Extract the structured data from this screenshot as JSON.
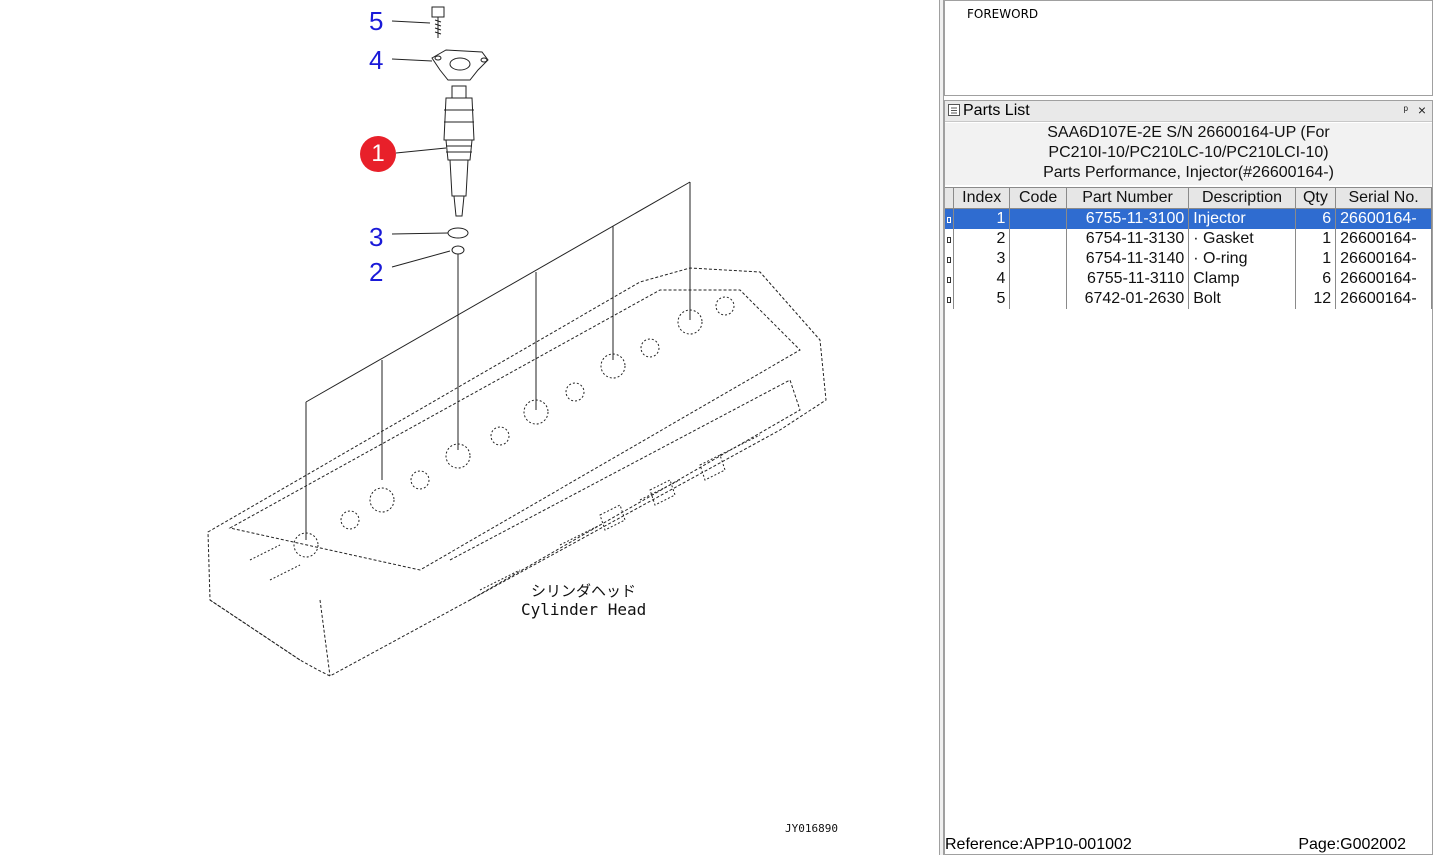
{
  "drawing": {
    "callouts": [
      {
        "label": "5"
      },
      {
        "label": "4"
      },
      {
        "label": "1"
      },
      {
        "label": "3"
      },
      {
        "label": "2"
      }
    ],
    "caption_jp": "シリンダヘッド",
    "caption_en": "Cylinder Head",
    "drawing_id": "JY016890"
  },
  "toc": {
    "item": "FOREWORD"
  },
  "parts_list": {
    "panel_title": "Parts List",
    "pin_glyph": "ᵖ",
    "close_glyph": "×",
    "title_lines": [
      "SAA6D107E-2E S/N 26600164-UP (For",
      "PC210I-10/PC210LC-10/PC210LCI-10)",
      "Parts Performance, Injector(#26600164-)"
    ],
    "columns": [
      "Index",
      "Code",
      "Part Number",
      "Description",
      "Qty",
      "Serial No."
    ],
    "rows": [
      {
        "index": "1",
        "code": "",
        "part_number": "6755-11-3100",
        "description": "Injector",
        "qty": "6",
        "serial": "26600164-"
      },
      {
        "index": "2",
        "code": "",
        "part_number": "6754-11-3130",
        "description": "· Gasket",
        "qty": "1",
        "serial": "26600164-"
      },
      {
        "index": "3",
        "code": "",
        "part_number": "6754-11-3140",
        "description": "· O-ring",
        "qty": "1",
        "serial": "26600164-"
      },
      {
        "index": "4",
        "code": "",
        "part_number": "6755-11-3110",
        "description": "Clamp",
        "qty": "6",
        "serial": "26600164-"
      },
      {
        "index": "5",
        "code": "",
        "part_number": "6742-01-2630",
        "description": "Bolt",
        "qty": "12",
        "serial": "26600164-"
      }
    ],
    "selected_row": 1
  },
  "status": {
    "reference": "Reference:APP10-001002",
    "page": "Page:G002002"
  },
  "colors": {
    "callout_blue": "#1a1ad8",
    "active_callout_red": "#e8202a",
    "selection_blue": "#2f6cd0"
  }
}
